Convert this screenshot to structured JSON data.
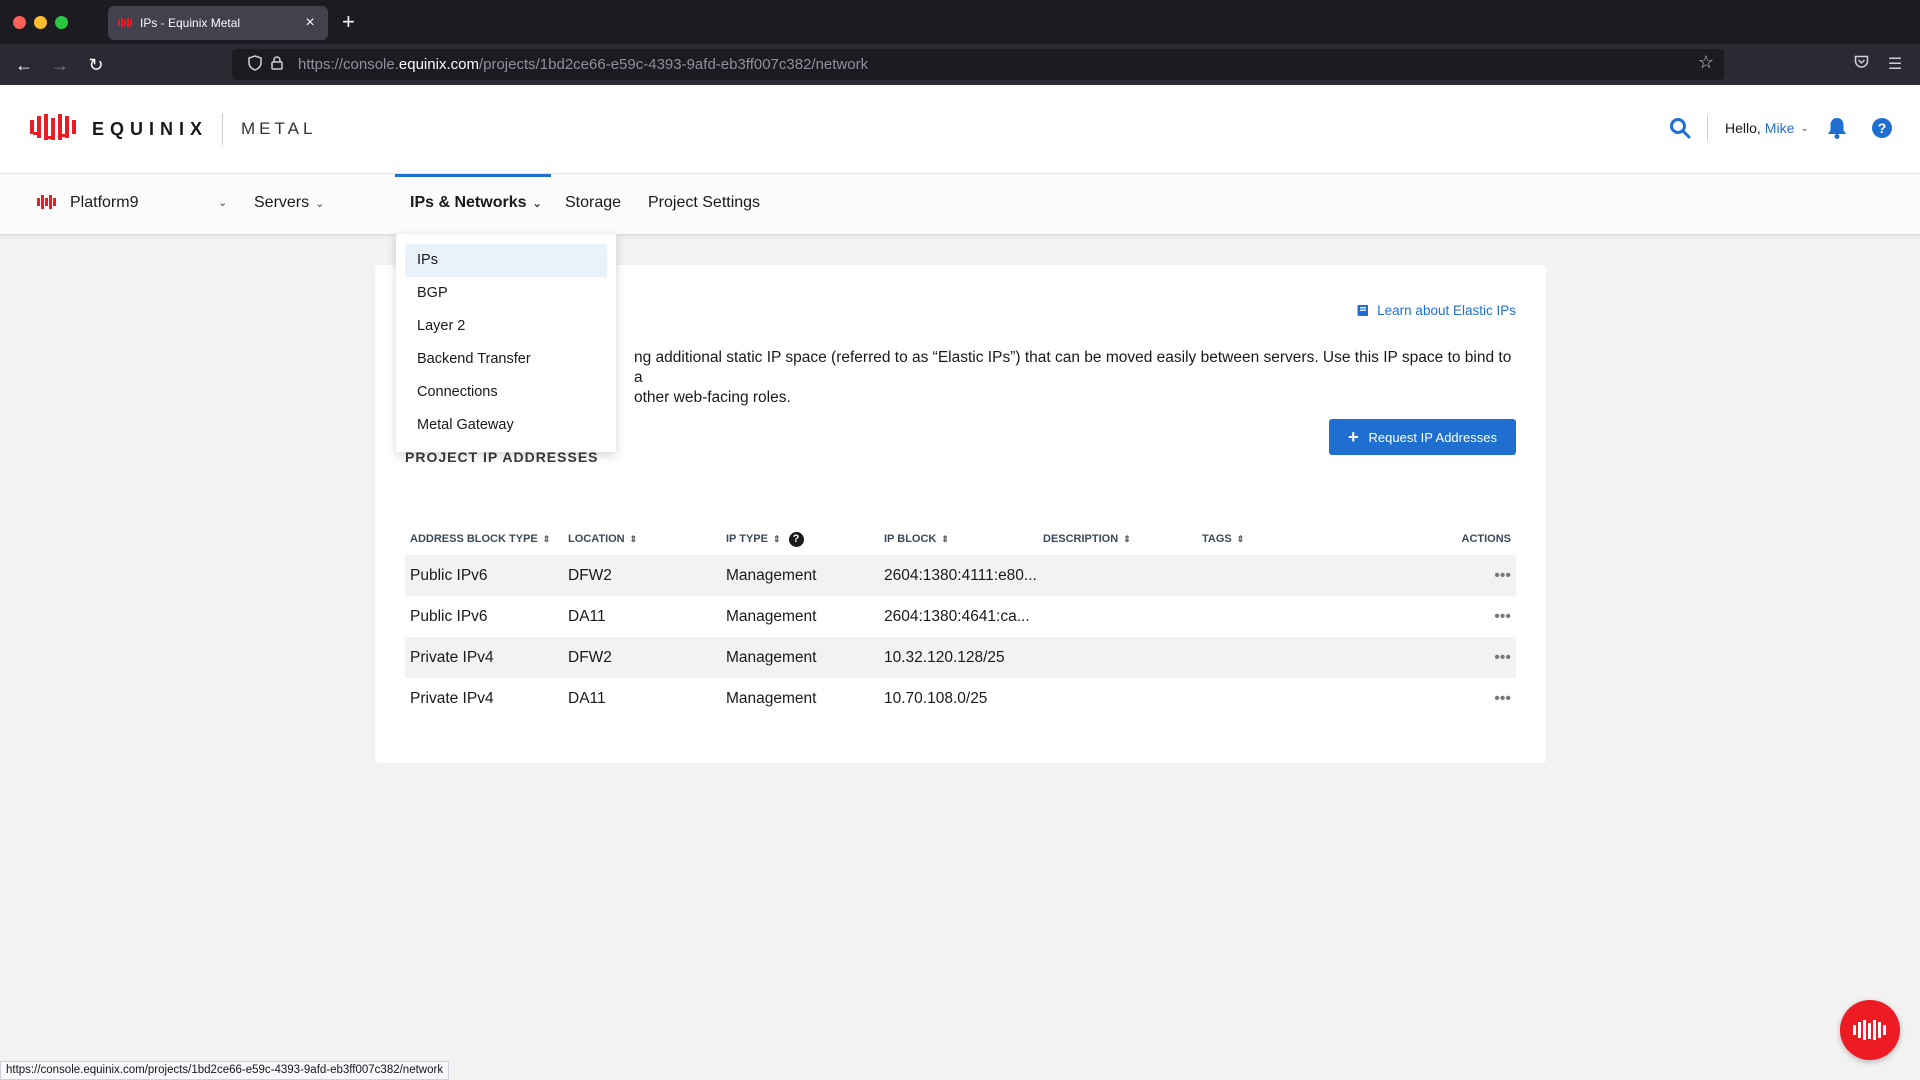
{
  "browser": {
    "tab_title": "IPs - Equinix Metal",
    "tab_close": "×",
    "new_tab": "+",
    "url_prefix": "https://console.",
    "url_domain": "equinix.com",
    "url_path": "/projects/1bd2ce66-e59c-4393-9afd-eb3ff007c382/network",
    "status_url": "https://console.equinix.com/projects/1bd2ce66-e59c-4393-9afd-eb3ff007c382/network"
  },
  "header": {
    "logo_word": "EQUINIX",
    "logo_sub": "METAL",
    "hello_prefix": "Hello,",
    "user_name": "Mike",
    "help_label": "?"
  },
  "subnav": {
    "project_name": "Platform9",
    "items": [
      {
        "label": "Servers"
      },
      {
        "label": "IPs & Networks"
      },
      {
        "label": "Storage"
      },
      {
        "label": "Project Settings"
      }
    ]
  },
  "dropdown": {
    "items": [
      {
        "label": "IPs"
      },
      {
        "label": "BGP"
      },
      {
        "label": "Layer 2"
      },
      {
        "label": "Backend Transfer"
      },
      {
        "label": "Connections"
      },
      {
        "label": "Metal Gateway"
      }
    ]
  },
  "main": {
    "learn_link": "Learn about Elastic IPs",
    "desc_line1": "ng additional static IP space (referred to as “Elastic IPs”) that can be moved easily between servers. Use this IP space to bind to a",
    "desc_line2": "other web-facing roles.",
    "request_button": "Request IP Addresses",
    "section_title": "PROJECT IP ADDRESSES",
    "columns": [
      "ADDRESS BLOCK TYPE",
      "LOCATION",
      "IP TYPE",
      "IP BLOCK",
      "DESCRIPTION",
      "TAGS",
      "ACTIONS"
    ],
    "rows": [
      {
        "type": "Public IPv6",
        "location": "DFW2",
        "ip_type": "Management",
        "block": "2604:1380:4111:e80...",
        "description": "",
        "tags": ""
      },
      {
        "type": "Public IPv6",
        "location": "DA11",
        "ip_type": "Management",
        "block": "2604:1380:4641:ca...",
        "description": "",
        "tags": ""
      },
      {
        "type": "Private IPv4",
        "location": "DFW2",
        "ip_type": "Management",
        "block": "10.32.120.128/25",
        "description": "",
        "tags": ""
      },
      {
        "type": "Private IPv4",
        "location": "DA11",
        "ip_type": "Management",
        "block": "10.70.108.0/25",
        "description": "",
        "tags": ""
      }
    ]
  },
  "colors": {
    "accent": "#1f6fd1",
    "brand_red": "#ed1c24"
  }
}
